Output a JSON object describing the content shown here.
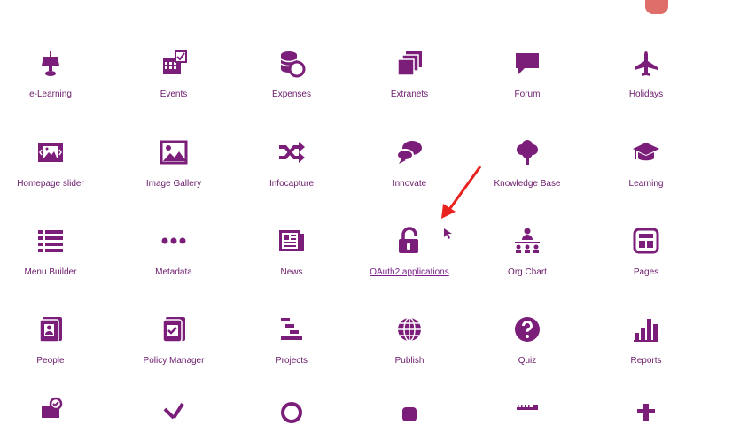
{
  "colors": {
    "icon": "#7b1e7a",
    "label": "#6a1a6a",
    "arrow": "#e8231f"
  },
  "apps": [
    {
      "label": "e-Learning",
      "icon": "lamp-icon"
    },
    {
      "label": "Events",
      "icon": "calendar-check-icon"
    },
    {
      "label": "Expenses",
      "icon": "coins-icon"
    },
    {
      "label": "Extranets",
      "icon": "stacked-pages-icon"
    },
    {
      "label": "Forum",
      "icon": "speech-bubble-icon"
    },
    {
      "label": "Holidays",
      "icon": "airplane-icon"
    },
    {
      "label": "Homepage slider",
      "icon": "slider-image-icon"
    },
    {
      "label": "Image Gallery",
      "icon": "image-icon"
    },
    {
      "label": "Infocapture",
      "icon": "shuffle-icon"
    },
    {
      "label": "Innovate",
      "icon": "chat-bubbles-icon"
    },
    {
      "label": "Knowledge Base",
      "icon": "tree-icon"
    },
    {
      "label": "Learning",
      "icon": "graduation-cap-icon"
    },
    {
      "label": "Menu Builder",
      "icon": "list-icon"
    },
    {
      "label": "Metadata",
      "icon": "ellipsis-icon"
    },
    {
      "label": "News",
      "icon": "newspaper-icon"
    },
    {
      "label": "OAuth2 applications",
      "icon": "unlock-icon"
    },
    {
      "label": "Org Chart",
      "icon": "org-chart-icon"
    },
    {
      "label": "Pages",
      "icon": "layout-icon"
    },
    {
      "label": "People",
      "icon": "contact-book-icon"
    },
    {
      "label": "Policy Manager",
      "icon": "checkbox-doc-icon"
    },
    {
      "label": "Projects",
      "icon": "gantt-icon"
    },
    {
      "label": "Publish",
      "icon": "globe-icon"
    },
    {
      "label": "Quiz",
      "icon": "question-circle-icon"
    },
    {
      "label": "Reports",
      "icon": "bar-chart-icon"
    }
  ]
}
